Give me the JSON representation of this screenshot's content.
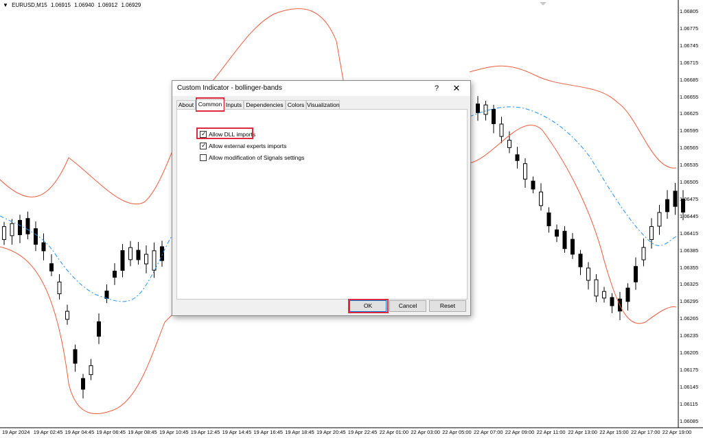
{
  "chart": {
    "symbol": "EURUSD,M15",
    "quotes": [
      "1.06915",
      "1.06940",
      "1.06912",
      "1.06929"
    ],
    "price_labels": [
      "1.06805",
      "1.06775",
      "1.06745",
      "1.06715",
      "1.06685",
      "1.06655",
      "1.06625",
      "1.06595",
      "1.06565",
      "1.06535",
      "1.06505",
      "1.06475",
      "1.06445",
      "1.06415",
      "1.06385",
      "1.06355",
      "1.06325",
      "1.06295",
      "1.06265",
      "1.06235",
      "1.06205",
      "1.06175",
      "1.06145",
      "1.06115",
      "1.06085"
    ],
    "time_labels": [
      "19 Apr 2024",
      "19 Apr 02:45",
      "19 Apr 04:45",
      "19 Apr 06:45",
      "19 Apr 08:45",
      "19 Apr 10:45",
      "19 Apr 12:45",
      "19 Apr 14:45",
      "19 Apr 16:45",
      "19 Apr 18:45",
      "19 Apr 20:45",
      "19 Apr 22:45",
      "22 Apr 01:00",
      "22 Apr 03:00",
      "22 Apr 05:00",
      "22 Apr 07:00",
      "22 Apr 09:00",
      "22 Apr 11:00",
      "22 Apr 13:00",
      "22 Apr 15:00",
      "22 Apr 17:00",
      "22 Apr 19:00"
    ],
    "colors": {
      "bands": "#f05a3c",
      "middle": "#1e90ff",
      "bull": "#ffffff",
      "bear": "#000000"
    }
  },
  "dialog": {
    "title": "Custom Indicator - bollinger-bands",
    "help_label": "?",
    "close_label": "✕",
    "tabs": [
      "About",
      "Common",
      "Inputs",
      "Dependencies",
      "Colors",
      "Visualization"
    ],
    "active_tab": "Common",
    "options": [
      {
        "label": "Allow DLL imports",
        "checked": true
      },
      {
        "label": "Allow external experts imports",
        "checked": true
      },
      {
        "label": "Allow modification of Signals settings",
        "checked": false
      }
    ],
    "buttons": {
      "ok": "OK",
      "cancel": "Cancel",
      "reset": "Reset"
    },
    "highlight_color": "#e0283c"
  }
}
